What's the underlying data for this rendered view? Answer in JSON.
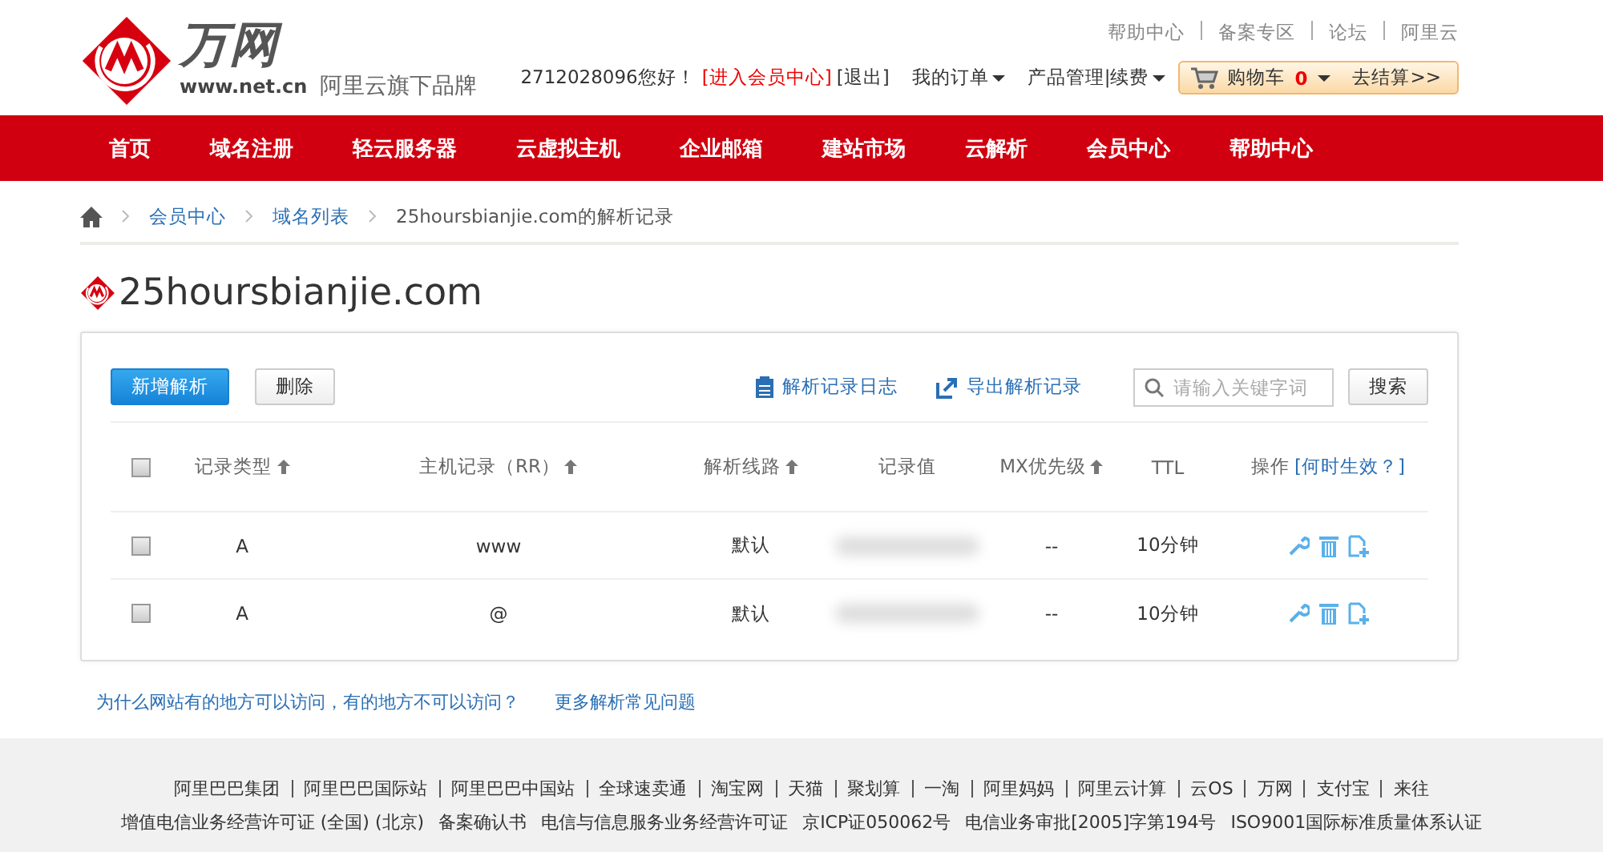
{
  "header": {
    "logo": {
      "name": "万网",
      "domain": "www.net.cn",
      "tagline": "阿里云旗下品牌"
    },
    "top_links": [
      "帮助中心",
      "备案专区",
      "论坛",
      "阿里云"
    ],
    "greeting": "2712028096您好！",
    "member_link": "[进入会员中心]",
    "logout": "[退出]",
    "menus": [
      "我的订单",
      "产品管理|续费"
    ],
    "cart": {
      "label": "购物车",
      "count": "0",
      "checkout": "去结算>>"
    }
  },
  "nav": [
    "首页",
    "域名注册",
    "轻云服务器",
    "云虚拟主机",
    "企业邮箱",
    "建站市场",
    "云解析",
    "会员中心",
    "帮助中心"
  ],
  "breadcrumb": [
    "会员中心",
    "域名列表",
    "25hoursbianjie.com的解析记录"
  ],
  "domain_title": "25hoursbianjie.com",
  "toolbar": {
    "add_button": "新增解析",
    "delete_button": "删除",
    "links": [
      "解析记录日志",
      "导出解析记录"
    ],
    "search": {
      "placeholder": "请输入关键字词"
    },
    "search_button": "搜索"
  },
  "table": {
    "header_checked": false,
    "columns": [
      {
        "label": "记录类型",
        "sortable": true
      },
      {
        "label": "主机记录（RR）",
        "sortable": true
      },
      {
        "label": "解析线路",
        "sortable": true
      },
      {
        "label": "记录值",
        "sortable": false
      },
      {
        "label": "MX优先级",
        "sortable": true
      },
      {
        "label": "TTL",
        "sortable": false
      },
      {
        "label": "操作",
        "sortable": false,
        "help": "[何时生效？]"
      }
    ],
    "rows": [
      {
        "checked": false,
        "type": "A",
        "host": "www",
        "line": "默认",
        "mx": "--",
        "ttl": "10分钟"
      },
      {
        "checked": false,
        "type": "A",
        "host": "@",
        "line": "默认",
        "mx": "--",
        "ttl": "10分钟"
      }
    ]
  },
  "help_links": [
    "为什么网站有的地方可以访问，有的地方不可以访问？",
    "更多解析常见问题"
  ],
  "footer": {
    "links": [
      "阿里巴巴集团",
      "阿里巴巴国际站",
      "阿里巴巴中国站",
      "全球速卖通",
      "淘宝网",
      "天猫",
      "聚划算",
      "一淘",
      "阿里妈妈",
      "阿里云计算",
      "云OS",
      "万网",
      "支付宝",
      "来往"
    ],
    "licenses": [
      "增值电信业务经营许可证 (全国) (北京)",
      "备案确认书",
      "电信与信息服务业务经营许可证",
      "京ICP证050062号",
      "电信业务审批[2005]字第194号",
      "ISO9001国际标准质量体系认证"
    ]
  }
}
